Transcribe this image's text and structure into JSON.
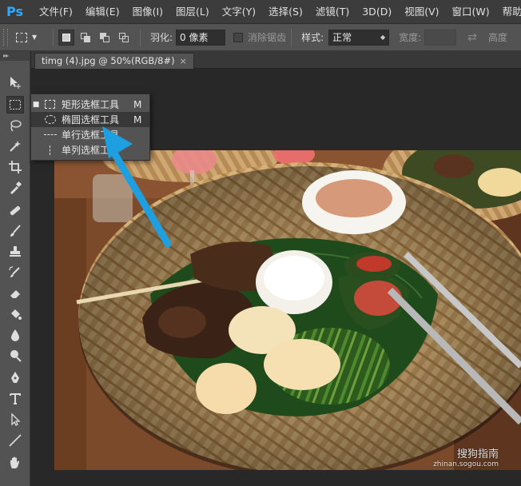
{
  "app": {
    "logo": "Ps"
  },
  "menu": [
    "文件(F)",
    "编辑(E)",
    "图像(I)",
    "图层(L)",
    "文字(Y)",
    "选择(S)",
    "滤镜(T)",
    "3D(D)",
    "视图(V)",
    "窗口(W)",
    "帮助(H)"
  ],
  "options": {
    "feather_label": "羽化:",
    "feather_value": "0 像素",
    "antialias_label": "消除锯齿",
    "style_label": "样式:",
    "style_value": "正常",
    "width_label": "宽度:",
    "height_label": "高度"
  },
  "document": {
    "tab_title": "timg (4).jpg @ 50%(RGB/8#)",
    "close_symbol": "×"
  },
  "flyout": {
    "items": [
      {
        "label": "矩形选框工具",
        "shortcut": "M",
        "icon": "rect-marquee-icon",
        "current": true
      },
      {
        "label": "椭圆选框工具",
        "shortcut": "M",
        "icon": "ellipse-marquee-icon",
        "current": false
      },
      {
        "label": "单行选框工具",
        "shortcut": "",
        "icon": "single-row-marquee-icon",
        "current": false
      },
      {
        "label": "单列选框工具",
        "shortcut": "",
        "icon": "single-column-marquee-icon",
        "current": false
      }
    ]
  },
  "watermark": {
    "main": "搜狗指南",
    "sub": "zhinan.sogou.com"
  },
  "colors": {
    "accent": "#31a8ff",
    "arrow": "#1ea0e0"
  }
}
